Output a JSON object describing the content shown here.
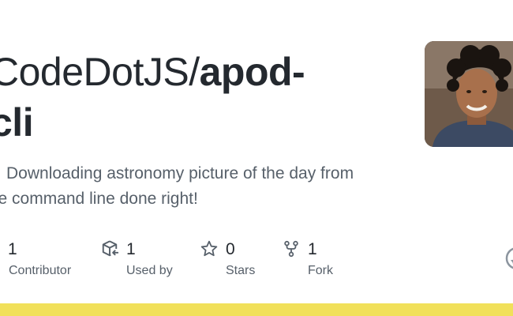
{
  "repo": {
    "owner": "CodeDotJS/",
    "name_part1": "apod-",
    "name_part2": "cli"
  },
  "description": {
    "line1": "Downloading astronomy picture of the day from",
    "line2": "the command line done right!",
    "emoji": "rocket-emoji"
  },
  "stats": [
    {
      "count": "1",
      "label": "Contributor",
      "icon": "people-icon"
    },
    {
      "count": "1",
      "label": "Used by",
      "icon": "package-dependents-icon"
    },
    {
      "count": "0",
      "label": "Stars",
      "icon": "star-icon"
    },
    {
      "count": "1",
      "label": "Fork",
      "icon": "repo-forked-icon"
    }
  ],
  "colors": {
    "language_bar": "#f1e05a",
    "text_primary": "#24292f",
    "text_secondary": "#57606a"
  }
}
